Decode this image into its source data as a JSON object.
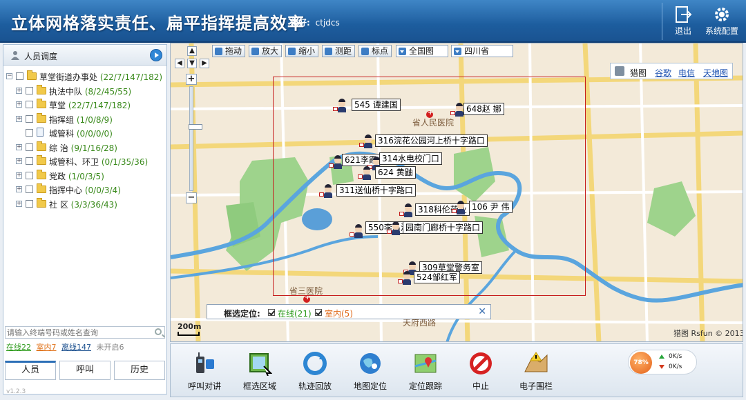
{
  "header": {
    "title": "立体网格落实责任、扁平指挥提高效率",
    "greeting_label": "您好:",
    "username": "ctjdcs",
    "exit_label": "退出",
    "config_label": "系统配置"
  },
  "left_panel": {
    "title": "人员调度",
    "tree": [
      {
        "label": "草堂街道办事处",
        "counts": "22/7/147/182",
        "level": 0,
        "type": "folder",
        "toggle": "−"
      },
      {
        "label": "执法中队",
        "counts": "8/2/45/55",
        "level": 1,
        "type": "folder",
        "toggle": "+"
      },
      {
        "label": "草堂",
        "counts": "22/7/147/182",
        "level": 1,
        "type": "folder",
        "toggle": "+"
      },
      {
        "label": "指挥组",
        "counts": "1/0/8/9",
        "level": 1,
        "type": "folder",
        "toggle": "+"
      },
      {
        "label": "城管科",
        "counts": "0/0/0/0",
        "level": 1,
        "type": "doc",
        "toggle": ""
      },
      {
        "label": "综 治",
        "counts": "9/1/16/28",
        "level": 1,
        "type": "folder",
        "toggle": "+"
      },
      {
        "label": "城管科、环卫",
        "counts": "0/1/35/36",
        "level": 1,
        "type": "folder",
        "toggle": "+"
      },
      {
        "label": "党政",
        "counts": "1/0/3/5",
        "level": 1,
        "type": "folder",
        "toggle": "+"
      },
      {
        "label": "指挥中心",
        "counts": "0/0/3/4",
        "level": 1,
        "type": "folder",
        "toggle": "+"
      },
      {
        "label": "社 区",
        "counts": "3/3/36/43",
        "level": 1,
        "type": "folder",
        "toggle": "+"
      }
    ],
    "search_placeholder": "请输入终端号码或姓名查询",
    "stats": {
      "online": "在线22",
      "indoor": "室内7",
      "offline": "离线147",
      "not_on": "未开启6"
    },
    "tabs": [
      "人员",
      "呼叫",
      "历史"
    ],
    "version": "v1.2.3"
  },
  "map": {
    "toolbar": [
      "拖动",
      "放大",
      "缩小",
      "测距",
      "标点"
    ],
    "select_all": "全国图",
    "select_province": "四川省",
    "map_types": {
      "label": "猎图",
      "opt1": "谷歌",
      "opt2": "电信",
      "opt3": "天地图"
    },
    "personnel": [
      {
        "id": "p1",
        "label": "545 谭建国"
      },
      {
        "id": "p2",
        "label": "648赵 娜"
      },
      {
        "id": "p3",
        "label": "316浣花公园河上桥十字路口"
      },
      {
        "id": "p4",
        "label": "621李霞"
      },
      {
        "id": "p5",
        "label": "314水电校门口"
      },
      {
        "id": "p6",
        "label": "624 黄鼬"
      },
      {
        "id": "p7",
        "label": "311送仙桥十字路口"
      },
      {
        "id": "p8",
        "label": "318科伦药业"
      },
      {
        "id": "p9",
        "label": "106 尹 伟"
      },
      {
        "id": "p10",
        "label": "550李昌温"
      },
      {
        "id": "p11",
        "label": "园南门廊桥十字路口"
      },
      {
        "id": "p12",
        "label": "309草堂警务室"
      },
      {
        "id": "p13",
        "label": "524邹红军"
      }
    ],
    "places": {
      "hospital1": "省人民医院",
      "hospital2": "省三医院",
      "road": "天府西路"
    },
    "filter": {
      "label": "框选定位:",
      "online": "在线(21)",
      "indoor": "室内(5)",
      "close": "✕"
    },
    "scale": "200m",
    "copyright": "猎图 Rsfun © 2013"
  },
  "bottom": {
    "buttons": [
      "呼叫对讲",
      "框选区域",
      "轨迹回放",
      "地图定位",
      "定位跟踪",
      "中止",
      "电子围栏"
    ],
    "speed": {
      "percent": "78%",
      "up": "0K/s",
      "down": "0K/s"
    }
  },
  "colors": {
    "header": "#1d5d9e",
    "online": "#2c9a1a",
    "indoor": "#e0721a",
    "selbox": "#c61e1e"
  }
}
